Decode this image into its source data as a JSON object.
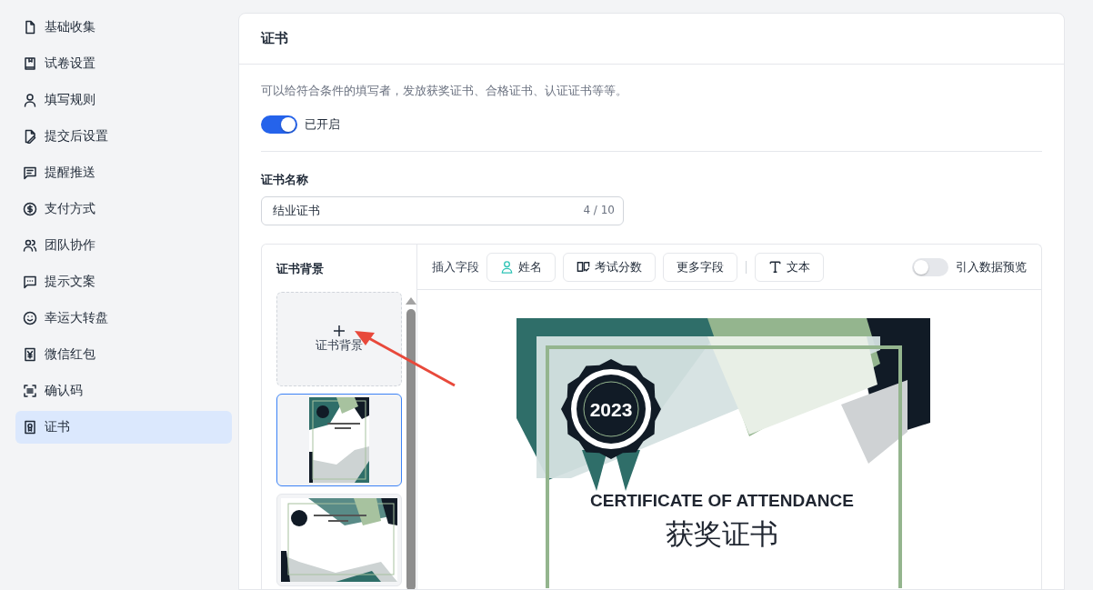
{
  "sidebar": {
    "items": [
      {
        "label": "基础收集",
        "selected": false
      },
      {
        "label": "试卷设置",
        "selected": false
      },
      {
        "label": "填写规则",
        "selected": false
      },
      {
        "label": "提交后设置",
        "selected": false
      },
      {
        "label": "提醒推送",
        "selected": false
      },
      {
        "label": "支付方式",
        "selected": false
      },
      {
        "label": "团队协作",
        "selected": false
      },
      {
        "label": "提示文案",
        "selected": false
      },
      {
        "label": "幸运大转盘",
        "selected": false
      },
      {
        "label": "微信红包",
        "selected": false
      },
      {
        "label": "确认码",
        "selected": false
      },
      {
        "label": "证书",
        "selected": true
      }
    ]
  },
  "card": {
    "title": "证书",
    "description": "可以给符合条件的填写者，发放获奖证书、合格证书、认证证书等等。",
    "switch": {
      "on": true,
      "label": "已开启"
    },
    "name_field": {
      "label": "证书名称",
      "value": "结业证书",
      "counter": "4 / 10"
    },
    "editor": {
      "backgrounds_title": "证书背景",
      "upload_label": "证书背景",
      "backgrounds": [
        {
          "kind": "portrait",
          "selected": true
        },
        {
          "kind": "landscape",
          "selected": false
        }
      ],
      "toolbar": {
        "label": "插入字段",
        "fields": [
          {
            "kind": "person",
            "label": "姓名"
          },
          {
            "kind": "book",
            "label": "考试分数"
          },
          {
            "kind": "none",
            "label": "更多字段"
          }
        ],
        "text_button": "文本",
        "preview_toggle": {
          "label": "引入数据预览",
          "on": false
        }
      },
      "preview": {
        "year": "2023",
        "title": "CERTIFICATE OF ATTENDANCE",
        "subtitle": "获奖证书"
      }
    }
  }
}
